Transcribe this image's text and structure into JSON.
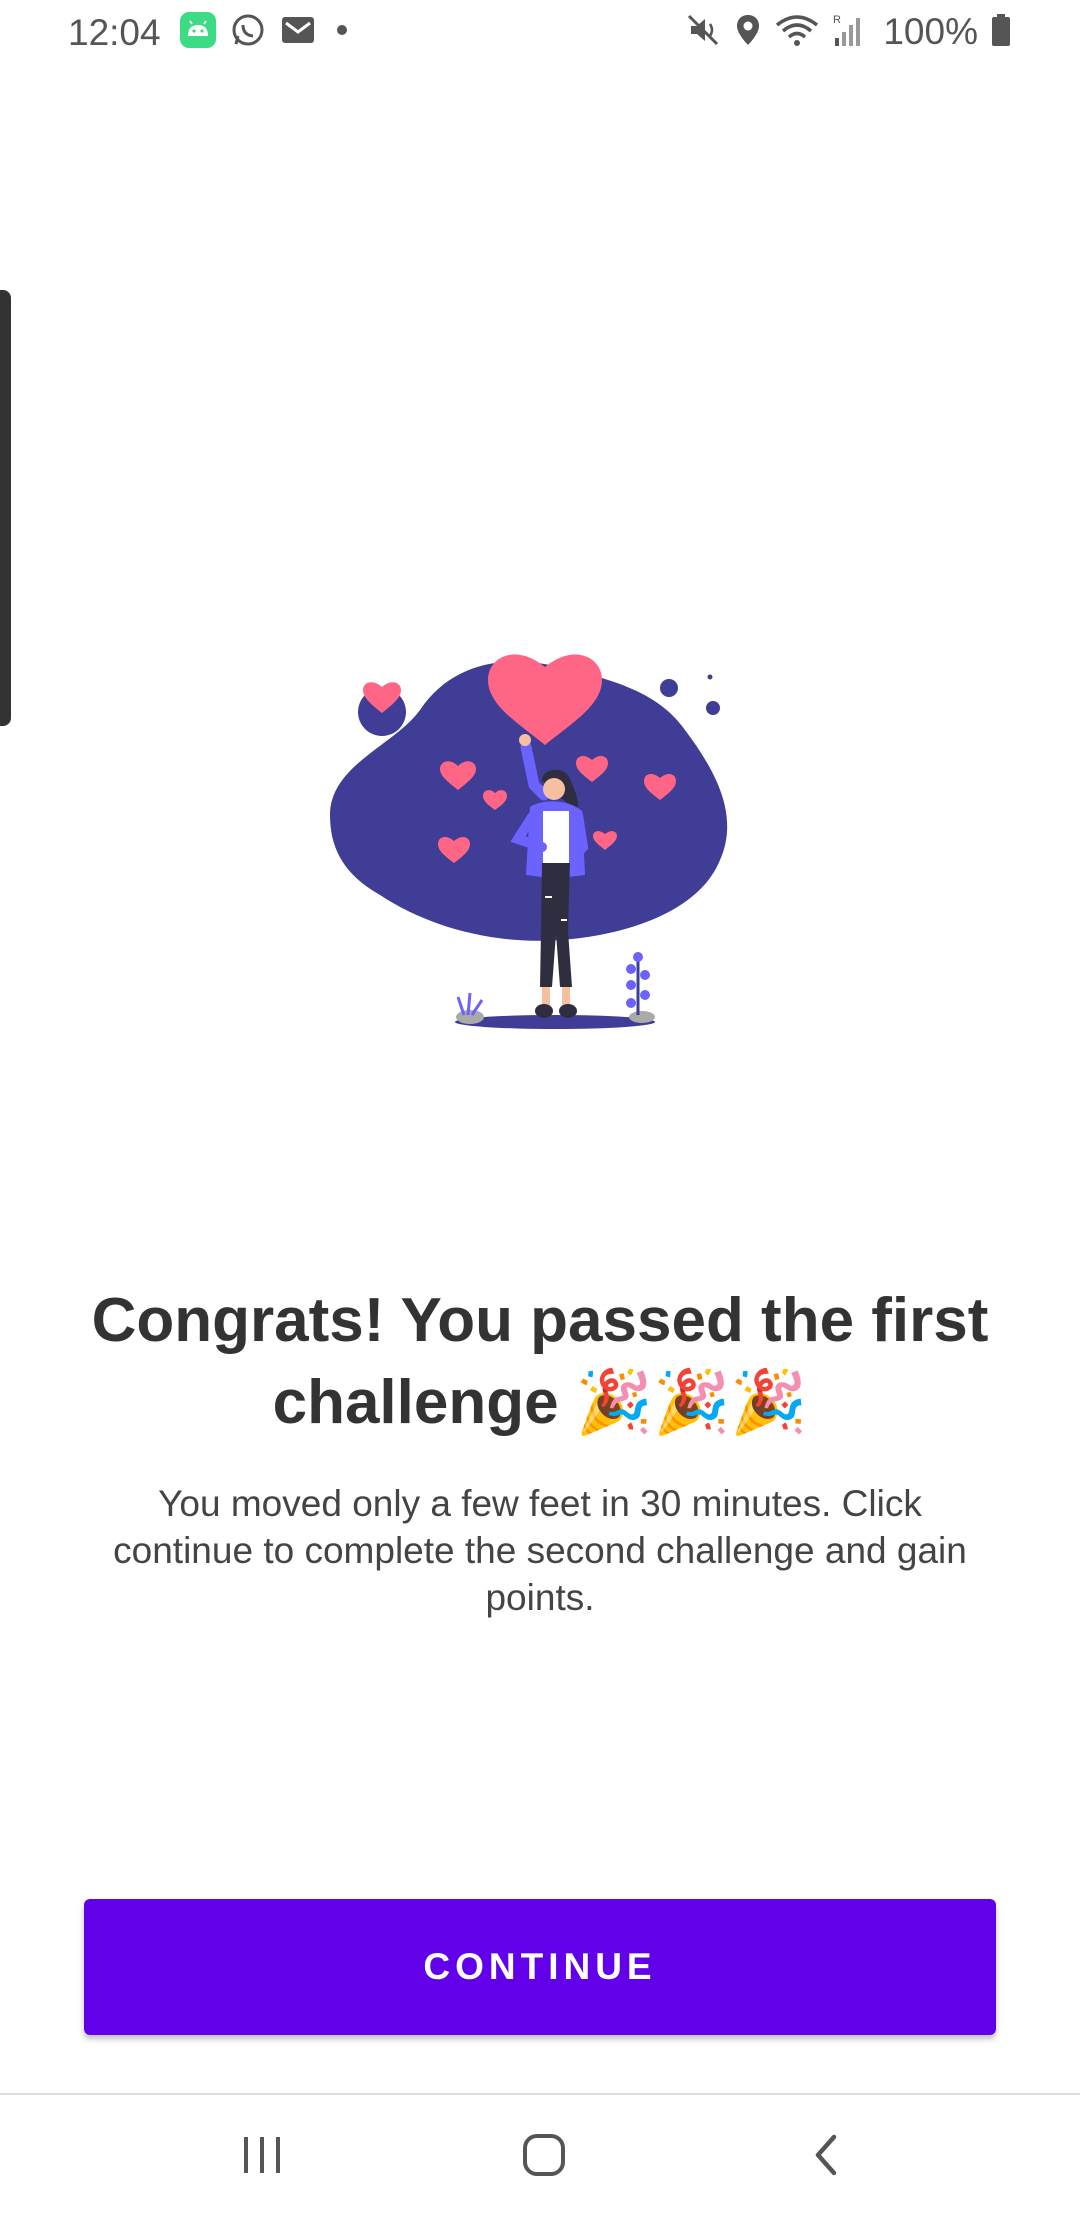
{
  "status_bar": {
    "time": "12:04",
    "battery": "100%",
    "left_icons": [
      "android-icon",
      "whatsapp-icon",
      "gmail-icon",
      "dot-icon"
    ],
    "right_icons": [
      "mute-icon",
      "location-icon",
      "wifi-icon",
      "signal-icon",
      "battery-icon"
    ]
  },
  "content": {
    "headline": "Congrats! You passed the first challenge 🎉🎉🎉",
    "body": "You moved only a few feet in 30 minutes. Click continue to complete the second challenge and gain points."
  },
  "actions": {
    "continue_label": "CONTINUE"
  },
  "nav_bar": {
    "items": [
      "recents-icon",
      "home-icon",
      "back-icon"
    ]
  },
  "colors": {
    "accent": "#6200ea",
    "blob": "#3f3d95",
    "heart": "#ff6584",
    "jacket": "#6c63ff"
  }
}
